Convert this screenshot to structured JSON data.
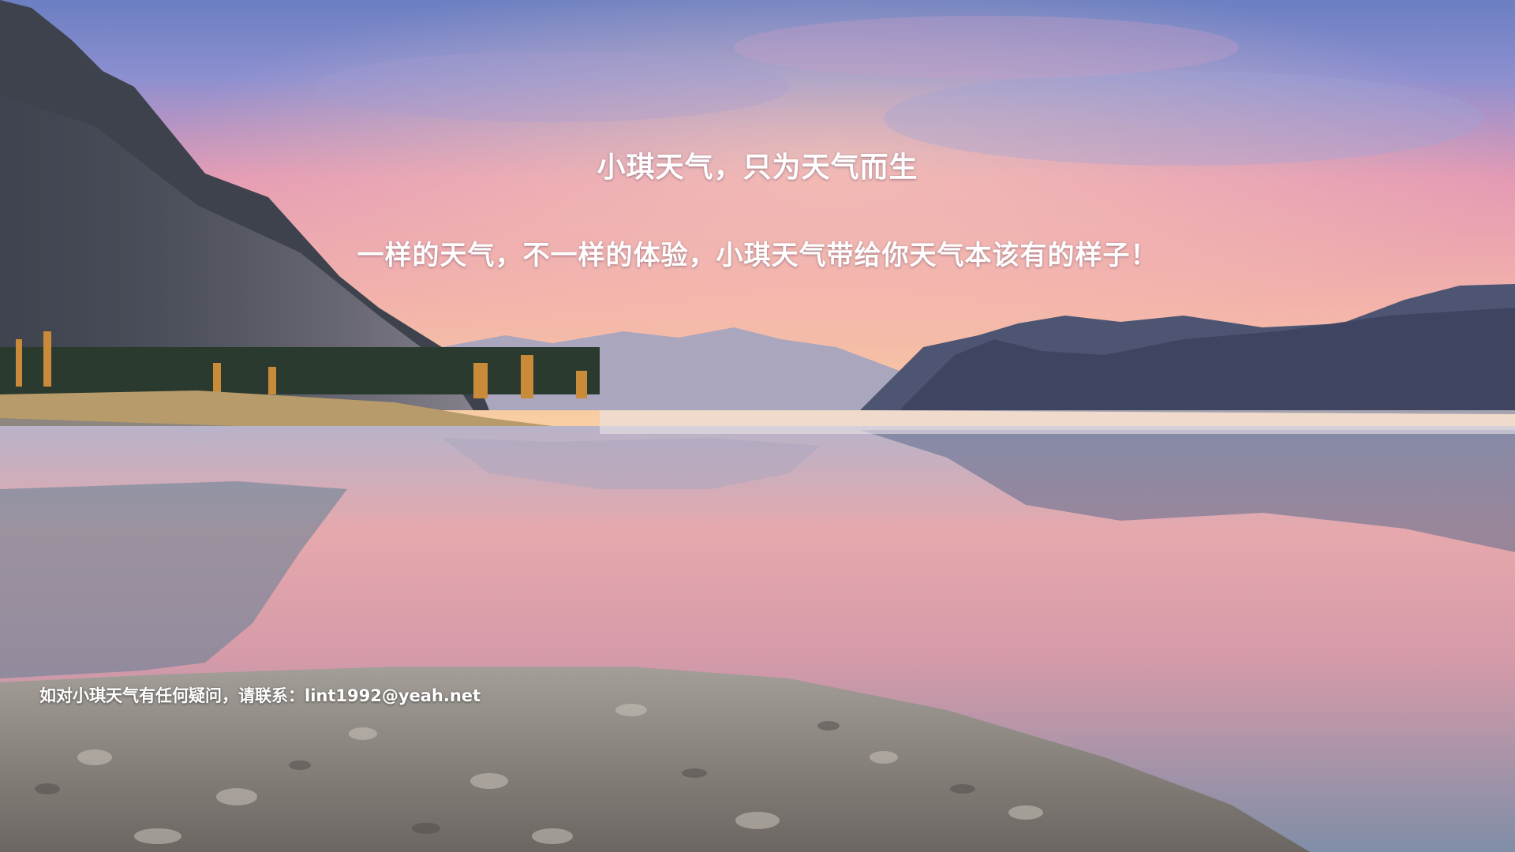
{
  "background": {
    "description_icon": "landscape-background-image",
    "colors": {
      "sky_top": "#6f83c4",
      "sky_pink": "#e9a3b6",
      "horizon_glow": "#f7c9a4",
      "mountain_dark": "#3b4255",
      "mountain_far": "#9aa0b8",
      "water": "#c7a9b8",
      "shore": "#9b948c"
    }
  },
  "hero": {
    "title": "小琪天气，只为天气而生",
    "subtitle": "一样的天气，不一样的体验，小琪天气带给你天气本该有的样子！"
  },
  "footer": {
    "contact_text": "如对小琪天气有任何疑问，请联系：lint1992@yeah.net"
  }
}
